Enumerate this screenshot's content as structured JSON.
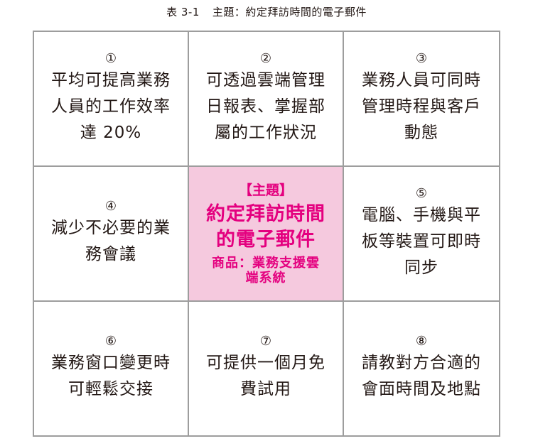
{
  "caption": {
    "number": "表 3-1",
    "title": "主題：約定拜訪時間的電子郵件"
  },
  "cells": [
    {
      "marker": "①",
      "text": "平均可提高業務\n人員的工作效率\n達 20%"
    },
    {
      "marker": "②",
      "text": "可透過雲端管理\n日報表、掌握部\n屬的工作狀況"
    },
    {
      "marker": "③",
      "text": "業務人員可同時\n管理時程與客戶\n動態"
    },
    {
      "marker": "④",
      "text": "減少不必要的業\n務會議"
    },
    {
      "marker": "⑤",
      "text": "電腦、手機與平\n板等裝置可即時\n同步"
    },
    {
      "marker": "⑥",
      "text": "業務窗口變更時\n可輕鬆交接"
    },
    {
      "marker": "⑦",
      "text": "可提供一個月免\n費試用"
    },
    {
      "marker": "⑧",
      "text": "請教對方合適的\n會面時間及地點"
    }
  ],
  "center": {
    "tag": "【主題】",
    "title": "約定拜訪時間\n的電子郵件",
    "product": "商品：業務支援雲\n端系統"
  },
  "colors": {
    "center_background": "#f5c9de",
    "center_text": "#e4007f",
    "border": "#9d9d9d"
  }
}
